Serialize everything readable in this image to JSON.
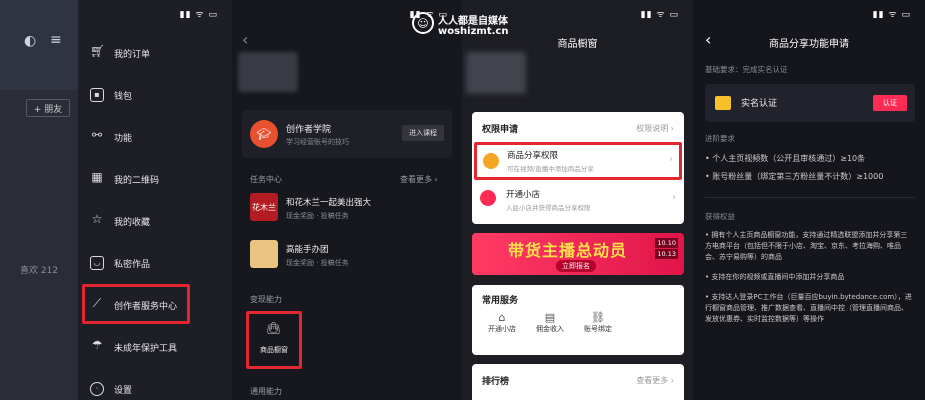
{
  "watermark": {
    "line1": "人人都是自媒体",
    "line2": "woshizmt.cn"
  },
  "status_bar": {
    "time": "",
    "icons": "▮▮ ᯤ ▭"
  },
  "panel1": {
    "friend_button": "+ 朋友",
    "likes": "喜欢 212",
    "menu": [
      {
        "label": "我的订单",
        "icon": "cart-icon"
      },
      {
        "label": "钱包",
        "icon": "wallet-icon"
      },
      {
        "label": "功能",
        "icon": "function-icon"
      },
      {
        "label": "我的二维码",
        "icon": "qrcode-icon"
      },
      {
        "label": "我的收藏",
        "icon": "star-icon"
      },
      {
        "label": "私密作品",
        "icon": "private-works-icon"
      },
      {
        "label": "创作者服务中心",
        "icon": "chart-icon"
      },
      {
        "label": "未成年保护工具",
        "icon": "umbrella-icon"
      },
      {
        "label": "设置",
        "icon": "settings-icon"
      }
    ]
  },
  "panel2": {
    "academy": {
      "title": "创作者学院",
      "subtitle": "学习经营账号的技巧",
      "button": "进入课程"
    },
    "tasks": {
      "title": "任务中心",
      "more": "查看更多",
      "items": [
        {
          "title": "和花木兰一起美出强大",
          "subtitle": "现金奖励 · 投稿任务",
          "thumb": "花木兰"
        },
        {
          "title": "高能手办团",
          "subtitle": "现金奖励 · 投稿任务"
        }
      ]
    },
    "monetize": {
      "title": "变现能力",
      "window_label": "商品橱窗"
    },
    "common": {
      "title": "通用能力"
    }
  },
  "panel3": {
    "title": "商品橱窗",
    "permissions": {
      "title": "权限申请",
      "explain": "权限说明",
      "items": [
        {
          "title": "商品分享权限",
          "subtitle": "可在视频/直播中添加商品分享"
        },
        {
          "title": "开通小店",
          "subtitle": "入驻小店并获得商品分享权限"
        }
      ]
    },
    "banner": {
      "title": "带货主播总动员",
      "subtitle": "立即报名",
      "dates": [
        "10.10",
        "10.13"
      ]
    },
    "services": {
      "title": "常用服务",
      "items": [
        {
          "label": "开通小店",
          "icon": "shop-icon"
        },
        {
          "label": "佣金收入",
          "icon": "income-icon"
        },
        {
          "label": "账号绑定",
          "icon": "link-icon"
        }
      ]
    },
    "ranking": {
      "title": "排行榜",
      "more": "查看更多"
    }
  },
  "panel4": {
    "title": "商品分享功能申请",
    "basic_req": "基础要求：完成实名认证",
    "realname": {
      "label": "实名认证",
      "button": "认证"
    },
    "advanced": {
      "title": "进阶要求",
      "items": [
        "个人主页视频数（公开且审核通过）≥10条",
        "账号粉丝量（绑定第三方粉丝量不计数）≥1000"
      ]
    },
    "rights": {
      "title": "获得权益",
      "items": [
        "拥有个人主页商品橱窗功能，支持通过精选联盟添加并分享第三方电商平台（包括但不限于小店、淘宝、京东、考拉海购、唯品会、苏宁易购等）的商品",
        "支持在你的视频或直播间中添加并分享商品",
        "支持达人登录PC工作台（巨量百应buyin.bytedance.com），进行橱窗商品管理、推广数据查看、直播间中控（管理直播间商品、发放优惠券、实时监控数据等）等操作"
      ]
    }
  },
  "colors": {
    "accent_red": "#e3262f",
    "brand_pink": "#fe2c55",
    "orange": "#f5a623"
  }
}
